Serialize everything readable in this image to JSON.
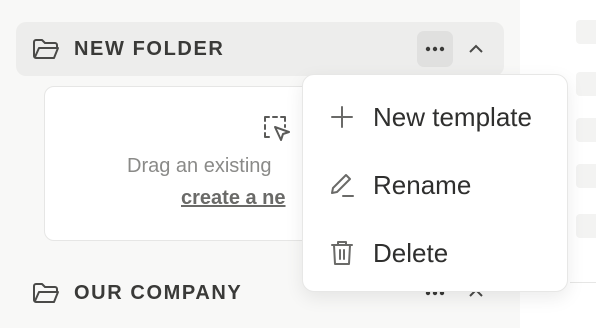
{
  "sidebar": {
    "folders": [
      {
        "label": "NEW FOLDER",
        "icon": "folder-icon"
      },
      {
        "label": "OUR COMPANY",
        "icon": "folder-icon"
      }
    ],
    "dropzone": {
      "text": "Drag an existing",
      "link": "create a ne",
      "icon": "drag-select-icon"
    }
  },
  "menu": {
    "items": [
      {
        "label": "New template",
        "icon": "plus-icon"
      },
      {
        "label": "Rename",
        "icon": "pencil-icon"
      },
      {
        "label": "Delete",
        "icon": "trash-icon"
      }
    ]
  },
  "colors": {
    "sidebar_bg": "#f8f8f7",
    "active_row_bg": "#ededec",
    "text_primary": "#3a3a38",
    "text_muted": "#8a8a88"
  }
}
